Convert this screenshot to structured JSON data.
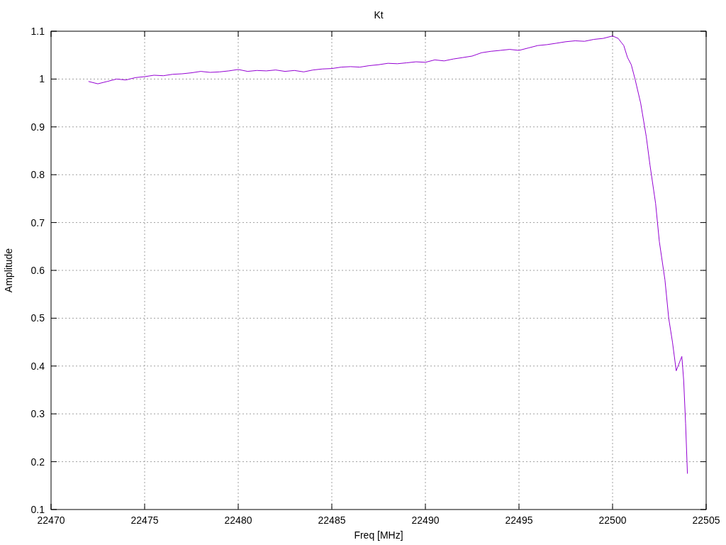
{
  "chart_data": {
    "type": "line",
    "title": "Kt",
    "xlabel": "Freq [MHz]",
    "ylabel": "Amplitude",
    "grid": true,
    "xlim": [
      22470,
      22505
    ],
    "ylim": [
      0.1,
      1.1
    ],
    "xticks": [
      22470,
      22475,
      22480,
      22485,
      22490,
      22495,
      22500,
      22505
    ],
    "yticks": [
      0.1,
      0.2,
      0.3,
      0.4,
      0.5,
      0.6,
      0.7,
      0.8,
      0.9,
      1,
      1.1
    ],
    "x": [
      22472,
      22472.5,
      22473,
      22473.5,
      22474,
      22474.5,
      22475,
      22475.5,
      22476,
      22476.5,
      22477,
      22477.5,
      22478,
      22478.5,
      22479,
      22479.5,
      22480,
      22480.5,
      22481,
      22481.5,
      22482,
      22482.5,
      22483,
      22483.5,
      22484,
      22484.5,
      22485,
      22485.5,
      22486,
      22486.5,
      22487,
      22487.5,
      22488,
      22488.5,
      22489,
      22489.5,
      22490,
      22490.5,
      22491,
      22491.5,
      22492,
      22492.5,
      22493,
      22493.5,
      22494,
      22494.5,
      22495,
      22495.5,
      22496,
      22496.5,
      22497,
      22497.5,
      22498,
      22498.5,
      22499,
      22499.5,
      22500,
      22500.3,
      22500.6,
      22500.8,
      22501,
      22501.2,
      22501.5,
      22501.8,
      22502,
      22502.3,
      22502.5,
      22502.8,
      22503,
      22503.2,
      22503.4,
      22503.6,
      22503.7,
      22503.8,
      22503.9,
      22504
    ],
    "series": [
      {
        "color": "#9400d3",
        "values": [
          0.995,
          0.99,
          0.995,
          1.0,
          0.998,
          1.003,
          1.005,
          1.008,
          1.007,
          1.01,
          1.011,
          1.013,
          1.016,
          1.014,
          1.015,
          1.017,
          1.02,
          1.016,
          1.018,
          1.017,
          1.019,
          1.016,
          1.018,
          1.015,
          1.019,
          1.021,
          1.022,
          1.025,
          1.026,
          1.025,
          1.028,
          1.03,
          1.033,
          1.032,
          1.034,
          1.036,
          1.035,
          1.04,
          1.038,
          1.042,
          1.045,
          1.048,
          1.055,
          1.058,
          1.06,
          1.062,
          1.06,
          1.065,
          1.07,
          1.072,
          1.075,
          1.078,
          1.08,
          1.079,
          1.083,
          1.085,
          1.09,
          1.085,
          1.07,
          1.045,
          1.03,
          1.0,
          0.95,
          0.88,
          0.82,
          0.74,
          0.66,
          0.58,
          0.5,
          0.45,
          0.39,
          0.41,
          0.42,
          0.37,
          0.28,
          0.175
        ]
      }
    ]
  }
}
